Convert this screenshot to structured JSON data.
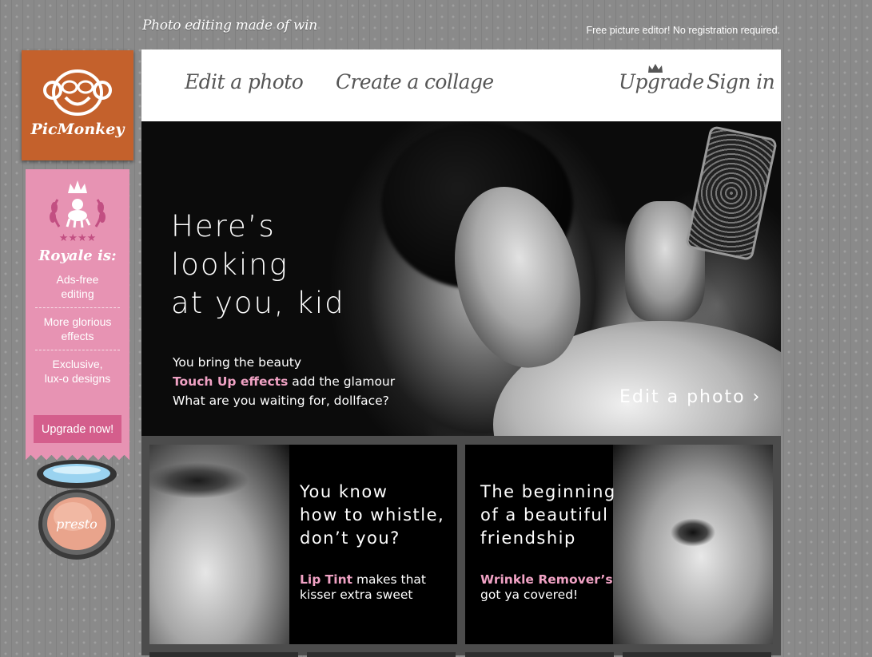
{
  "header": {
    "tagline": "Photo editing made of win",
    "subtitle": "Free picture editor! No registration required."
  },
  "logo": {
    "brand": "PicMonkey",
    "icon": "monkey-face-icon",
    "color": "#c4612c"
  },
  "royale": {
    "title": "Royale is:",
    "emblem": "crowned-monkey-laurel-icon",
    "features": [
      "Ads-free\nediting",
      "More glorious\neffects",
      "Exclusive,\nlux-o designs"
    ],
    "button_label": "Upgrade now!",
    "color": "#e793b3",
    "button_color": "#d45e8c"
  },
  "compact": {
    "label": "presto"
  },
  "nav": {
    "edit_photo": "Edit a photo",
    "create_collage": "Create a collage",
    "upgrade": "Upgrade",
    "sign_in": "Sign in",
    "upgrade_icon": "crown-icon"
  },
  "hero": {
    "title": "Here’s\nlooking\nat you, kid",
    "line1": "You bring the beauty",
    "highlight": "Touch Up effects",
    "line2_rest": " add the glamour",
    "line3": "What are you waiting for, dollface?",
    "cta": "Edit a photo ›"
  },
  "cards": [
    {
      "title": "You know\nhow to whistle,\ndon’t you?",
      "highlight": "Lip Tint",
      "text_rest": " makes that\nkisser extra sweet"
    },
    {
      "title": "The beginning\nof a beautiful\nfriendship",
      "highlight": "Wrinkle Remover’s",
      "text_rest": "\ngot ya covered!"
    }
  ],
  "colors": {
    "accent_pink": "#f0a2c4",
    "background": "#8a8a8a"
  }
}
